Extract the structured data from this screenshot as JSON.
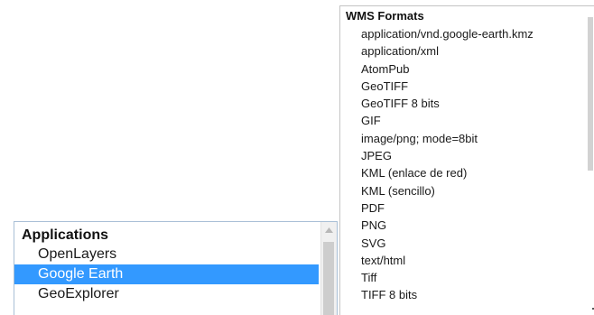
{
  "applications": {
    "header": "Applications",
    "items": [
      {
        "label": "OpenLayers",
        "selected": false
      },
      {
        "label": "Google Earth",
        "selected": true
      },
      {
        "label": "GeoExplorer",
        "selected": false
      }
    ],
    "selection_color": "#3399ff",
    "scroll_up_icon": "triangle-up-icon"
  },
  "wms_formats": {
    "header": "WMS Formats",
    "items": [
      "application/vnd.google-earth.kmz",
      "application/xml",
      "AtomPub",
      "GeoTIFF",
      "GeoTIFF 8 bits",
      "GIF",
      "image/png; mode=8bit",
      "JPEG",
      "KML (enlace de red)",
      "KML (sencillo)",
      "PDF",
      "PNG",
      "SVG",
      "text/html",
      "Tiff",
      "TIFF 8 bits"
    ]
  }
}
